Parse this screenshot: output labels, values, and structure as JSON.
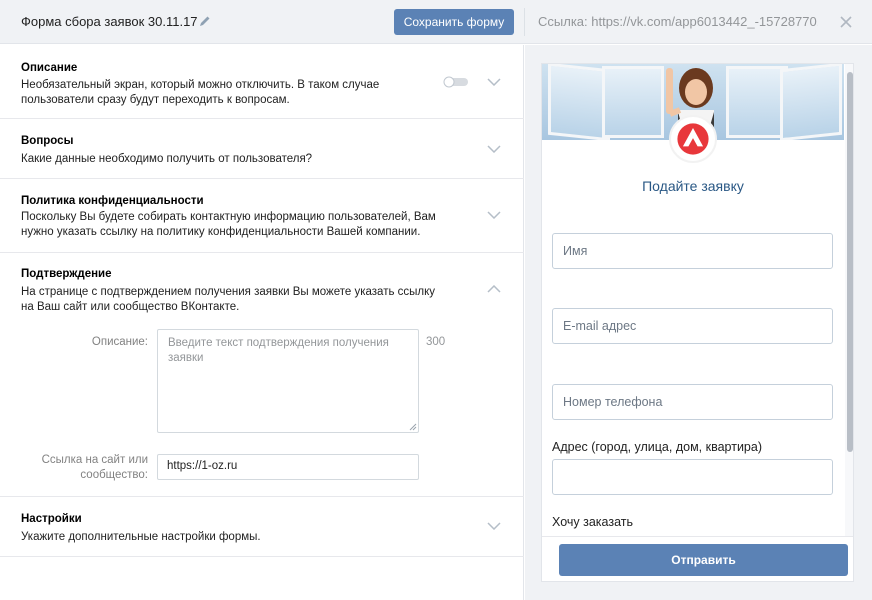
{
  "header": {
    "form_title": "Форма сбора заявок 30.11.17",
    "save_label": "Сохранить форму",
    "link_text": "Ссылка: https://vk.com/app6013442_-15728770..."
  },
  "sections": [
    {
      "title": "Описание",
      "desc": "Необязательный экран, который можно отключить. В таком случае пользователи сразу будут переходить к вопросам.",
      "toggle": "off",
      "expanded": false
    },
    {
      "title": "Вопросы",
      "desc": "Какие данные необходимо получить от пользователя?",
      "expanded": false
    },
    {
      "title": "Политика конфиденциальности",
      "desc": "Поскольку Вы будете собирать контактную информацию пользователей, Вам нужно указать ссылку на политику конфиденциальности Вашей компании.",
      "expanded": false
    },
    {
      "title": "Подтверждение",
      "desc": "На странице с подтверждением получения заявки Вы можете указать ссылку на Ваш сайт или сообщество ВКонтакте.",
      "expanded": true,
      "description_label": "Описание:",
      "description_placeholder": "Введите текст подтверждения получения заявки",
      "char_counter": "300",
      "link_label_line1": "Ссылка на сайт или",
      "link_label_line2": "сообщество:",
      "link_value": "https://1-oz.ru"
    },
    {
      "title": "Настройки",
      "desc": "Укажите дополнительные настройки формы.",
      "expanded": false
    }
  ],
  "preview": {
    "title": "Подайте заявку",
    "name_placeholder": "Имя",
    "email_placeholder": "E-mail адрес",
    "phone_placeholder": "Номер телефона",
    "address_label": "Адрес (город, улица, дом, квартира)",
    "order_label": "Хочу заказать",
    "submit_label": "Отправить",
    "accent_color": "#5b82b5",
    "logo_color": "#e8373b"
  }
}
